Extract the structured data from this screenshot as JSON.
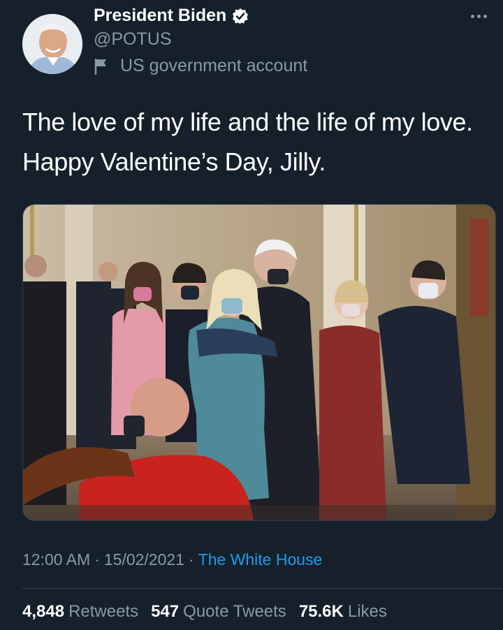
{
  "account": {
    "display_name": "President Biden",
    "handle": "@POTUS",
    "label": "US government account",
    "verified_icon": "verified-badge-icon",
    "label_icon": "flag-icon"
  },
  "tweet": {
    "lines": [
      "The love of my life and the life of my love.",
      "Happy Valentine’s Day, Jilly."
    ]
  },
  "meta": {
    "time": "12:00 AM",
    "date": "15/02/2021",
    "source": "The White House",
    "separator": "·"
  },
  "stats": {
    "retweets_count": "4,848",
    "retweets_label": "Retweets",
    "quote_count": "547",
    "quote_label": "Quote Tweets",
    "likes_count": "75.6K",
    "likes_label": "Likes"
  },
  "colors": {
    "background": "#15202b",
    "secondary_text": "#8b98a5",
    "link": "#1d9bf0"
  }
}
